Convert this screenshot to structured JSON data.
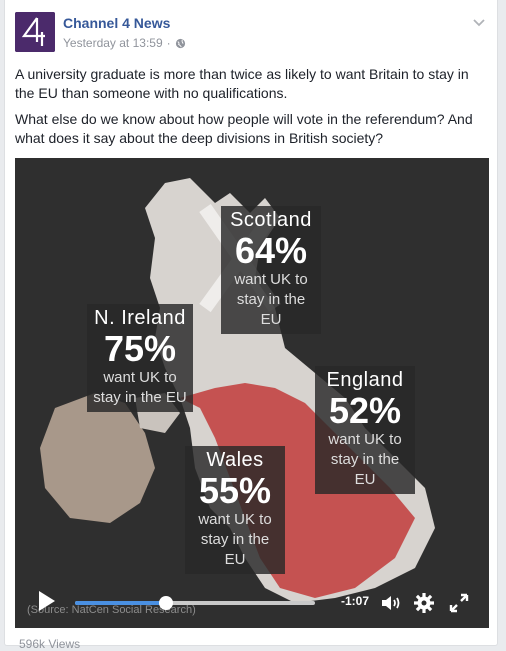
{
  "post": {
    "page_name": "Channel 4 News",
    "timestamp": "Yesterday at 13:59",
    "separator": "·",
    "privacy_icon": "globe-icon",
    "menu_icon": "chevron-down-icon",
    "paragraphs": [
      "A university graduate is more than twice as likely to want Britain to stay in the EU than someone with no qualifications.",
      "What else do we know about how people will vote in the referendum? And what does it say about the deep divisions in British society?"
    ],
    "views": "596k Views"
  },
  "video": {
    "stats": [
      {
        "region": "Scotland",
        "pct": "64%",
        "line1": "want UK to",
        "line2": "stay in the EU"
      },
      {
        "region": "N. Ireland",
        "pct": "75%",
        "line1": "want UK to",
        "line2": "stay in the EU"
      },
      {
        "region": "England",
        "pct": "52%",
        "line1": "want UK to",
        "line2": "stay in the EU"
      },
      {
        "region": "Wales",
        "pct": "55%",
        "line1": "want UK to",
        "line2": "stay in the EU"
      }
    ],
    "source": "(Source: NatCen Social Research)",
    "time_remaining": "-1:07",
    "progress_fraction": 0.38,
    "accent_color": "#4a90e2"
  }
}
